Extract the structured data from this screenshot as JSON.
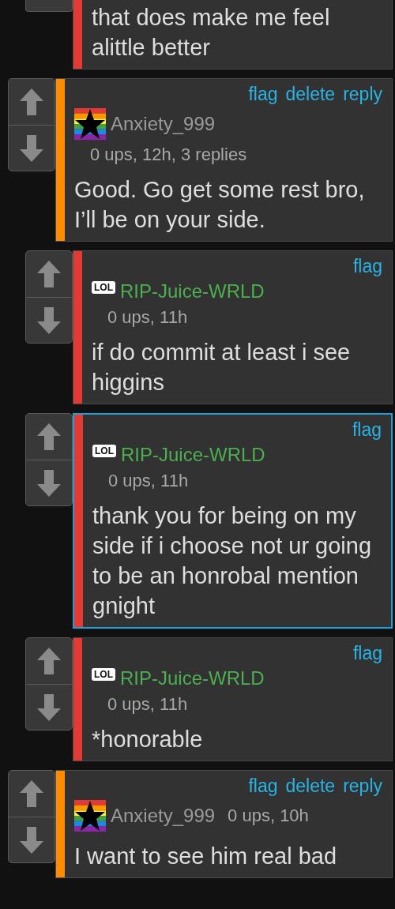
{
  "partial_reply": {
    "color": "#e53935",
    "body": "that does make me feel alittle better"
  },
  "threads": [
    {
      "avatar": {
        "kind": "rainbow-star"
      },
      "user": {
        "name": "Anxiety_999",
        "color": "#9a9a9a"
      },
      "color": "#ff8c00",
      "selected": false,
      "meta_inline": false,
      "actions": [
        "flag",
        "delete",
        "reply"
      ],
      "meta": "0 ups, 12h, 3 replies",
      "body": "Good. Go get some rest bro, I’ll be on your side.",
      "children": [
        {
          "avatar": {
            "kind": "lol",
            "text": "LOL"
          },
          "user": {
            "name": "RIP-Juice-WRLD",
            "color": "#4caf50"
          },
          "color": "#e53935",
          "selected": false,
          "meta_inline": false,
          "actions": [
            "flag"
          ],
          "meta": "0 ups, 11h",
          "body": "if do commit at least i see higgins"
        },
        {
          "avatar": {
            "kind": "lol",
            "text": "LOL"
          },
          "user": {
            "name": "RIP-Juice-WRLD",
            "color": "#4caf50"
          },
          "color": "#e53935",
          "selected": true,
          "meta_inline": false,
          "actions": [
            "flag"
          ],
          "meta": "0 ups, 11h",
          "body": "thank you for being on my side if i choose not ur going to be an honrobal mention gnight"
        },
        {
          "avatar": {
            "kind": "lol",
            "text": "LOL"
          },
          "user": {
            "name": "RIP-Juice-WRLD",
            "color": "#4caf50"
          },
          "color": "#e53935",
          "selected": false,
          "meta_inline": false,
          "actions": [
            "flag"
          ],
          "meta": "0 ups, 11h",
          "body": "*honorable"
        }
      ]
    },
    {
      "avatar": {
        "kind": "rainbow-star"
      },
      "user": {
        "name": "Anxiety_999",
        "color": "#9a9a9a"
      },
      "color": "#ff8c00",
      "selected": false,
      "meta_inline": true,
      "actions": [
        "flag",
        "delete",
        "reply"
      ],
      "meta": "0 ups, 10h",
      "body": "I want to see him real bad"
    }
  ]
}
